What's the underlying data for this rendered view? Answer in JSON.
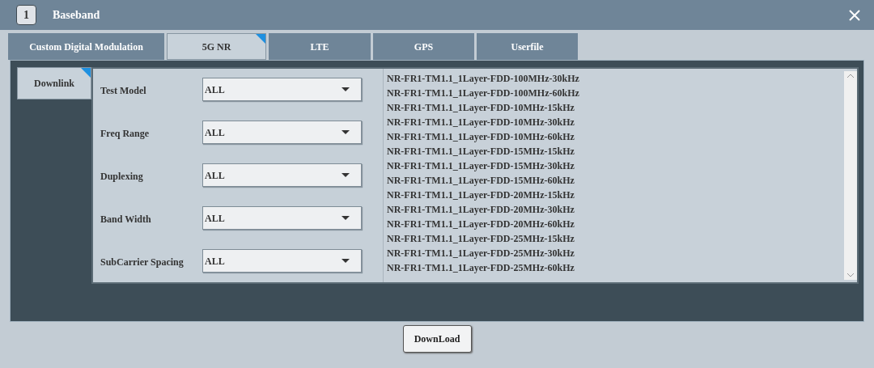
{
  "window": {
    "number": "1",
    "title": "Baseband"
  },
  "tabs": [
    {
      "label": "Custom Digital Modulation",
      "selected": false
    },
    {
      "label": "5G NR",
      "selected": true
    },
    {
      "label": "LTE",
      "selected": false
    },
    {
      "label": "GPS",
      "selected": false
    },
    {
      "label": "Userfile",
      "selected": false
    }
  ],
  "side_tabs": [
    {
      "label": "Downlink",
      "selected": true
    }
  ],
  "fields": [
    {
      "label": "Test Model",
      "value": "ALL"
    },
    {
      "label": "Freq Range",
      "value": "ALL"
    },
    {
      "label": "Duplexing",
      "value": "ALL"
    },
    {
      "label": "Band Width",
      "value": "ALL"
    },
    {
      "label": "SubCarrier Spacing",
      "value": "ALL"
    }
  ],
  "list": {
    "items": [
      "NR-FR1-TM1.1_1Layer-FDD-100MHz-30kHz",
      "NR-FR1-TM1.1_1Layer-FDD-100MHz-60kHz",
      "NR-FR1-TM1.1_1Layer-FDD-10MHz-15kHz",
      "NR-FR1-TM1.1_1Layer-FDD-10MHz-30kHz",
      "NR-FR1-TM1.1_1Layer-FDD-10MHz-60kHz",
      "NR-FR1-TM1.1_1Layer-FDD-15MHz-15kHz",
      "NR-FR1-TM1.1_1Layer-FDD-15MHz-30kHz",
      "NR-FR1-TM1.1_1Layer-FDD-15MHz-60kHz",
      "NR-FR1-TM1.1_1Layer-FDD-20MHz-15kHz",
      "NR-FR1-TM1.1_1Layer-FDD-20MHz-30kHz",
      "NR-FR1-TM1.1_1Layer-FDD-20MHz-60kHz",
      "NR-FR1-TM1.1_1Layer-FDD-25MHz-15kHz",
      "NR-FR1-TM1.1_1Layer-FDD-25MHz-30kHz",
      "NR-FR1-TM1.1_1Layer-FDD-25MHz-60kHz"
    ]
  },
  "buttons": [
    {
      "label": "DownLoad"
    }
  ]
}
